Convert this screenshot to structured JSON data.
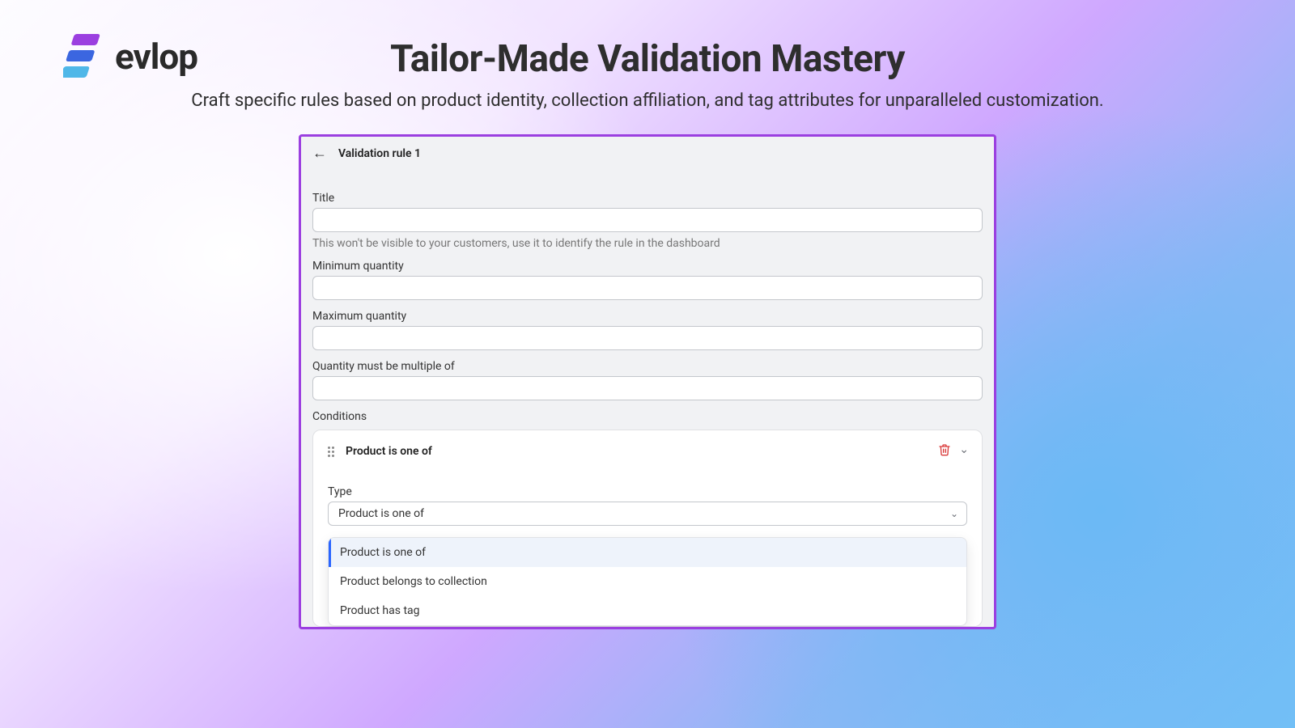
{
  "brand": {
    "name": "evlop"
  },
  "hero": {
    "title": "Tailor-Made Validation Mastery",
    "subtitle": "Craft specific rules based on product identity, collection affiliation, and tag attributes for unparalleled customization."
  },
  "panel": {
    "back_icon": "arrow-left",
    "title": "Validation rule 1",
    "fields": {
      "title": {
        "label": "Title",
        "value": "",
        "help": "This won't be visible to your customers, use it to identify the rule in the dashboard"
      },
      "min_qty": {
        "label": "Minimum quantity",
        "value": ""
      },
      "max_qty": {
        "label": "Maximum quantity",
        "value": ""
      },
      "multiple_of": {
        "label": "Quantity must be multiple of",
        "value": ""
      }
    },
    "conditions": {
      "label": "Conditions",
      "card": {
        "drag_icon": "drag-handle",
        "title": "Product is one of",
        "delete_icon": "trash",
        "toggle_icon": "chevron-down",
        "type": {
          "label": "Type",
          "selected": "Product is one of",
          "options": [
            "Product is one of",
            "Product belongs to collection",
            "Product has tag"
          ]
        }
      }
    }
  }
}
